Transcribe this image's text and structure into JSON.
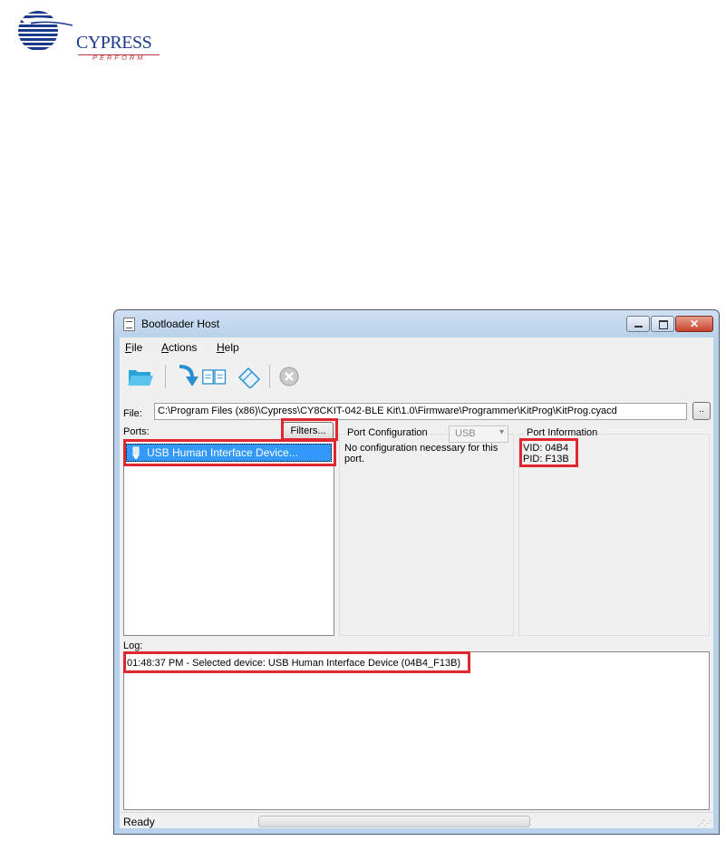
{
  "logo": {
    "name": "CYPRESS",
    "tagline": "PERFORM"
  },
  "window": {
    "title": "Bootloader Host"
  },
  "menu": {
    "file": "File",
    "actions": "Actions",
    "help": "Help"
  },
  "toolbar": {
    "icons": [
      "open-folder-icon",
      "program-icon",
      "verify-icon",
      "erase-icon",
      "abort-icon"
    ]
  },
  "file_row": {
    "label": "File:",
    "path": "C:\\Program Files (x86)\\Cypress\\CY8CKIT-042-BLE Kit\\1.0\\Firmware\\Programmer\\KitProg\\KitProg.cyacd",
    "browse_label": ".."
  },
  "ports": {
    "label": "Ports:",
    "filters_label": "Filters...",
    "items": [
      {
        "label": "USB Human Interface Device..."
      }
    ]
  },
  "port_configuration": {
    "title": "Port Configuration",
    "selected": "USB",
    "message": "No configuration necessary for this port."
  },
  "port_information": {
    "title": "Port Information",
    "vid": "VID: 04B4",
    "pid": "PID: F13B"
  },
  "log": {
    "label": "Log:",
    "entries": [
      "01:48:37 PM - Selected device: USB Human Interface Device (04B4_F13B)"
    ]
  },
  "status": {
    "text": "Ready",
    "progress": 0
  },
  "colors": {
    "highlight": "#e0262f",
    "selection": "#3399ff",
    "brand": "#1b3a8c"
  }
}
